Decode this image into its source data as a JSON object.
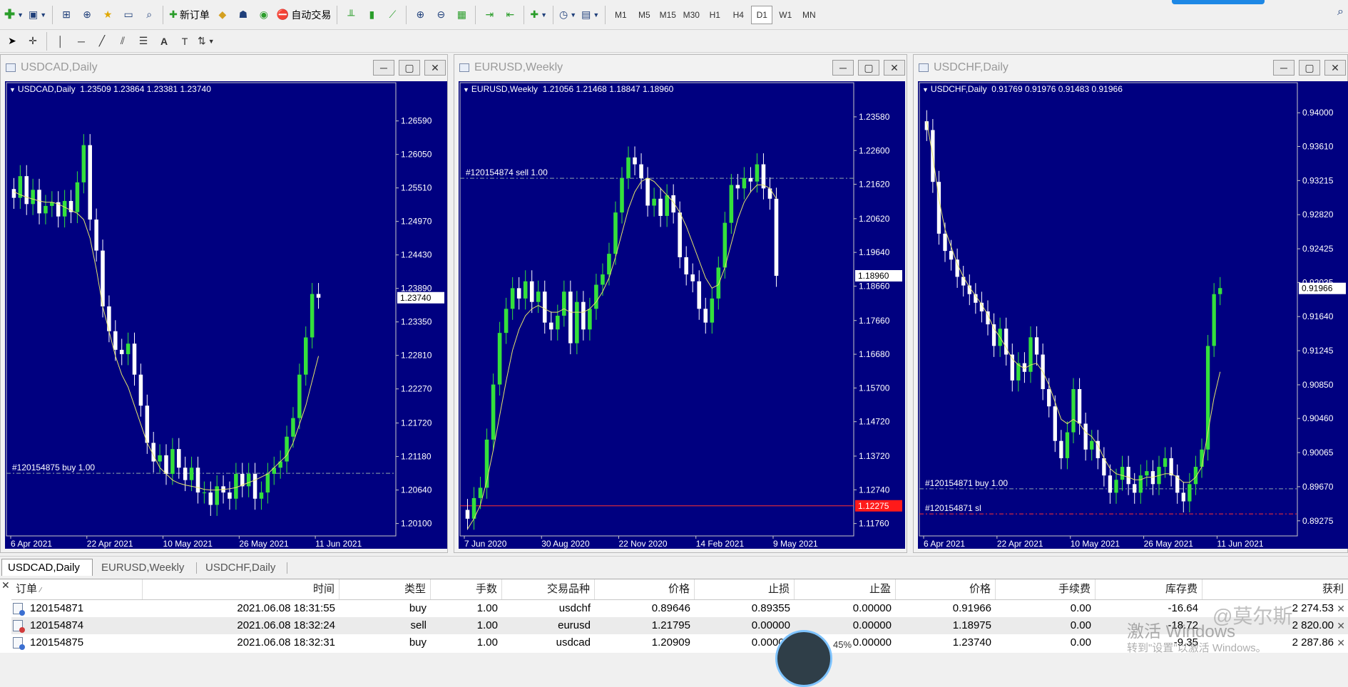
{
  "toolbar": {
    "new_order_label": "新订单",
    "auto_trading_label": "自动交易",
    "timeframes": [
      "M1",
      "M5",
      "M15",
      "M30",
      "H1",
      "H4",
      "D1",
      "W1",
      "MN"
    ],
    "active_timeframe": "D1"
  },
  "colors": {
    "chart_bg": "#000080",
    "bull_candle": "#34e03c",
    "bear_candle": "#ffffff",
    "ma_line": "#e4e46a",
    "order_line": "#8fa8a8",
    "sl_line": "#ff3030",
    "price_tag_red": "#ff1a1a"
  },
  "charts": [
    {
      "title": "USDCAD,Daily",
      "symbol": "USDCAD",
      "period": "Daily",
      "open": "1.23509",
      "high": "1.23864",
      "low": "1.23381",
      "close": "1.23740",
      "price_tag": "1.23740",
      "ticks": [
        "1.26590",
        "1.26050",
        "1.25510",
        "1.24970",
        "1.24430",
        "1.23890",
        "1.23350",
        "1.22810",
        "1.22270",
        "1.21720",
        "1.21180",
        "1.20640",
        "1.20100"
      ],
      "tick_values": [
        1.2659,
        1.2605,
        1.2551,
        1.2497,
        1.2443,
        1.2389,
        1.2335,
        1.2281,
        1.2227,
        1.2172,
        1.2118,
        1.2064,
        1.201
      ],
      "dates": [
        "6 Apr 2021",
        "22 Apr 2021",
        "10 May 2021",
        "26 May 2021",
        "11 Jun 2021"
      ],
      "date_bars": [
        0,
        12,
        24,
        36,
        48
      ],
      "order_lines": [
        {
          "text": "#120154875 buy 1.00",
          "price": 1.20909,
          "kind": "order"
        }
      ],
      "tag_price": 1.2374,
      "chart_data": {
        "type": "candlestick",
        "ylim": [
          1.199,
          1.27
        ],
        "closes": [
          1.2535,
          1.257,
          1.2525,
          1.2548,
          1.251,
          1.2522,
          1.2528,
          1.2505,
          1.253,
          1.2512,
          1.256,
          1.262,
          1.25,
          1.245,
          1.236,
          1.232,
          1.229,
          1.2283,
          1.23,
          1.225,
          1.22,
          1.214,
          1.211,
          1.212,
          1.209,
          1.213,
          1.21,
          1.208,
          1.21,
          1.206,
          1.206,
          1.204,
          1.207,
          1.206,
          1.205,
          1.209,
          1.207,
          1.209,
          1.205,
          1.206,
          1.209,
          1.21,
          1.211,
          1.215,
          1.218,
          1.225,
          1.231,
          1.238,
          1.2374
        ],
        "ma": [
          1.2545,
          1.254,
          1.2536,
          1.2533,
          1.253,
          1.2528,
          1.2528,
          1.2525,
          1.252,
          1.2515,
          1.251,
          1.25,
          1.247,
          1.242,
          1.236,
          1.232,
          1.228,
          1.225,
          1.223,
          1.22,
          1.217,
          1.214,
          1.212,
          1.21,
          1.209,
          1.208,
          1.2075,
          1.2072,
          1.207,
          1.2068,
          1.2065,
          1.2064,
          1.2064,
          1.2065,
          1.2066,
          1.2068,
          1.2072,
          1.2076,
          1.208,
          1.2085,
          1.209,
          1.21,
          1.211,
          1.212,
          1.214,
          1.217,
          1.22,
          1.224,
          1.228
        ]
      }
    },
    {
      "title": "EURUSD,Weekly",
      "symbol": "EURUSD",
      "period": "Weekly",
      "open": "1.21056",
      "high": "1.21468",
      "low": "1.18847",
      "close": "1.18960",
      "price_tag": "1.18960",
      "sl_tag": "1.12275",
      "ticks": [
        "1.23580",
        "1.22600",
        "1.21620",
        "1.20620",
        "1.19640",
        "1.18660",
        "1.17660",
        "1.16680",
        "1.15700",
        "1.14720",
        "1.13720",
        "1.12740",
        "1.11760"
      ],
      "tick_values": [
        1.2358,
        1.226,
        1.2162,
        1.2062,
        1.1964,
        1.1866,
        1.1766,
        1.1668,
        1.157,
        1.1472,
        1.1372,
        1.1274,
        1.1176
      ],
      "dates": [
        "7 Jun 2020",
        "30 Aug 2020",
        "22 Nov 2020",
        "14 Feb 2021",
        "9 May 2021"
      ],
      "date_bars": [
        0,
        12,
        24,
        36,
        48
      ],
      "order_lines": [
        {
          "text": "#120154874 sell 1.00",
          "price": 1.21795,
          "kind": "order"
        },
        {
          "text": "",
          "price": 1.12275,
          "kind": "sl"
        }
      ],
      "tag_price": 1.1896,
      "chart_data": {
        "type": "candlestick",
        "ylim": [
          1.114,
          1.242
        ],
        "closes": [
          1.119,
          1.125,
          1.128,
          1.142,
          1.158,
          1.173,
          1.18,
          1.186,
          1.183,
          1.188,
          1.182,
          1.185,
          1.176,
          1.174,
          1.178,
          1.185,
          1.17,
          1.182,
          1.174,
          1.18,
          1.187,
          1.19,
          1.196,
          1.208,
          1.218,
          1.224,
          1.222,
          1.218,
          1.21,
          1.212,
          1.207,
          1.213,
          1.208,
          1.195,
          1.19,
          1.188,
          1.18,
          1.176,
          1.183,
          1.192,
          1.205,
          1.216,
          1.215,
          1.218,
          1.217,
          1.222,
          1.215,
          1.212,
          1.1896
        ],
        "ma": [
          1.116,
          1.119,
          1.123,
          1.13,
          1.139,
          1.149,
          1.159,
          1.168,
          1.174,
          1.178,
          1.18,
          1.181,
          1.18,
          1.179,
          1.179,
          1.18,
          1.179,
          1.179,
          1.179,
          1.18,
          1.182,
          1.185,
          1.189,
          1.195,
          1.202,
          1.209,
          1.214,
          1.217,
          1.218,
          1.217,
          1.215,
          1.213,
          1.211,
          1.208,
          1.204,
          1.199,
          1.194,
          1.189,
          1.186,
          1.187,
          1.192,
          1.199,
          1.206,
          1.211,
          1.214,
          1.216,
          1.216,
          1.215,
          1.212
        ]
      }
    },
    {
      "title": "USDCHF,Daily",
      "symbol": "USDCHF",
      "period": "Daily",
      "open": "0.91769",
      "high": "0.91976",
      "low": "0.91483",
      "close": "0.91966",
      "price_tag": "0.91966",
      "ticks": [
        "0.94000",
        "0.93610",
        "0.93215",
        "0.92820",
        "0.92425",
        "0.92035",
        "0.91640",
        "0.91245",
        "0.90850",
        "0.90460",
        "0.90065",
        "0.89670",
        "0.89275"
      ],
      "tick_values": [
        0.94,
        0.9361,
        0.93215,
        0.9282,
        0.92425,
        0.92035,
        0.9164,
        0.91245,
        0.9085,
        0.9046,
        0.90065,
        0.8967,
        0.89275
      ],
      "dates": [
        "6 Apr 2021",
        "22 Apr 2021",
        "10 May 2021",
        "26 May 2021",
        "11 Jun 2021"
      ],
      "date_bars": [
        0,
        12,
        24,
        36,
        48
      ],
      "order_lines": [
        {
          "text": "#120154871 buy 1.00",
          "price": 0.89646,
          "kind": "order"
        },
        {
          "text": "#120154871 sl",
          "price": 0.89355,
          "kind": "sl"
        }
      ],
      "tag_price": 0.91966,
      "chart_data": {
        "type": "candlestick",
        "ylim": [
          0.891,
          0.942
        ],
        "closes": [
          0.938,
          0.932,
          0.926,
          0.924,
          0.923,
          0.921,
          0.92,
          0.919,
          0.918,
          0.917,
          0.9155,
          0.913,
          0.915,
          0.912,
          0.909,
          0.911,
          0.91,
          0.914,
          0.912,
          0.908,
          0.906,
          0.902,
          0.9,
          0.903,
          0.908,
          0.904,
          0.901,
          0.902,
          0.9,
          0.898,
          0.896,
          0.8975,
          0.899,
          0.897,
          0.896,
          0.898,
          0.8985,
          0.897,
          0.899,
          0.9,
          0.898,
          0.896,
          0.895,
          0.897,
          0.899,
          0.901,
          0.913,
          0.919,
          0.9197
        ],
        "ma": [
          0.939,
          0.935,
          0.93,
          0.9265,
          0.9245,
          0.9225,
          0.921,
          0.9198,
          0.9188,
          0.9178,
          0.9166,
          0.915,
          0.914,
          0.9128,
          0.9115,
          0.9108,
          0.9104,
          0.9108,
          0.911,
          0.91,
          0.9085,
          0.9065,
          0.9045,
          0.904,
          0.9045,
          0.904,
          0.903,
          0.9025,
          0.9015,
          0.9,
          0.8988,
          0.8982,
          0.898,
          0.8978,
          0.8975,
          0.8975,
          0.8978,
          0.8978,
          0.898,
          0.8982,
          0.8982,
          0.8978,
          0.8972,
          0.8972,
          0.8978,
          0.899,
          0.903,
          0.907,
          0.91
        ]
      }
    }
  ],
  "tabs": [
    "USDCAD,Daily",
    "EURUSD,Weekly",
    "USDCHF,Daily"
  ],
  "terminal": {
    "columns": [
      "订单",
      "时间",
      "类型",
      "手数",
      "交易品种",
      "价格",
      "止损",
      "止盈",
      "价格",
      "手续费",
      "库存费",
      "获利"
    ],
    "rows": [
      {
        "order": "120154871",
        "time": "2021.06.08 18:31:55",
        "type": "buy",
        "lots": "1.00",
        "symbol": "usdchf",
        "open_price": "0.89646",
        "sl": "0.89355",
        "tp": "0.00000",
        "price": "0.91966",
        "commission": "0.00",
        "swap": "-16.64",
        "profit": "2 274.53"
      },
      {
        "order": "120154874",
        "time": "2021.06.08 18:32:24",
        "type": "sell",
        "lots": "1.00",
        "symbol": "eurusd",
        "open_price": "1.21795",
        "sl": "0.00000",
        "tp": "0.00000",
        "price": "1.18975",
        "commission": "0.00",
        "swap": "-18.72",
        "profit": "2 820.00"
      },
      {
        "order": "120154875",
        "time": "2021.06.08 18:32:31",
        "type": "buy",
        "lots": "1.00",
        "symbol": "usdcad",
        "open_price": "1.20909",
        "sl": "0.00000",
        "tp": "0.00000",
        "price": "1.23740",
        "commission": "0.00",
        "swap": "-9.35",
        "profit": "2 287.86"
      }
    ]
  },
  "overlay": {
    "watermark_line1": "激活 Windows",
    "watermark_line2": "转到\"设置\"以激活 Windows。",
    "brand": "@莫尔斯",
    "speed": "45%"
  }
}
